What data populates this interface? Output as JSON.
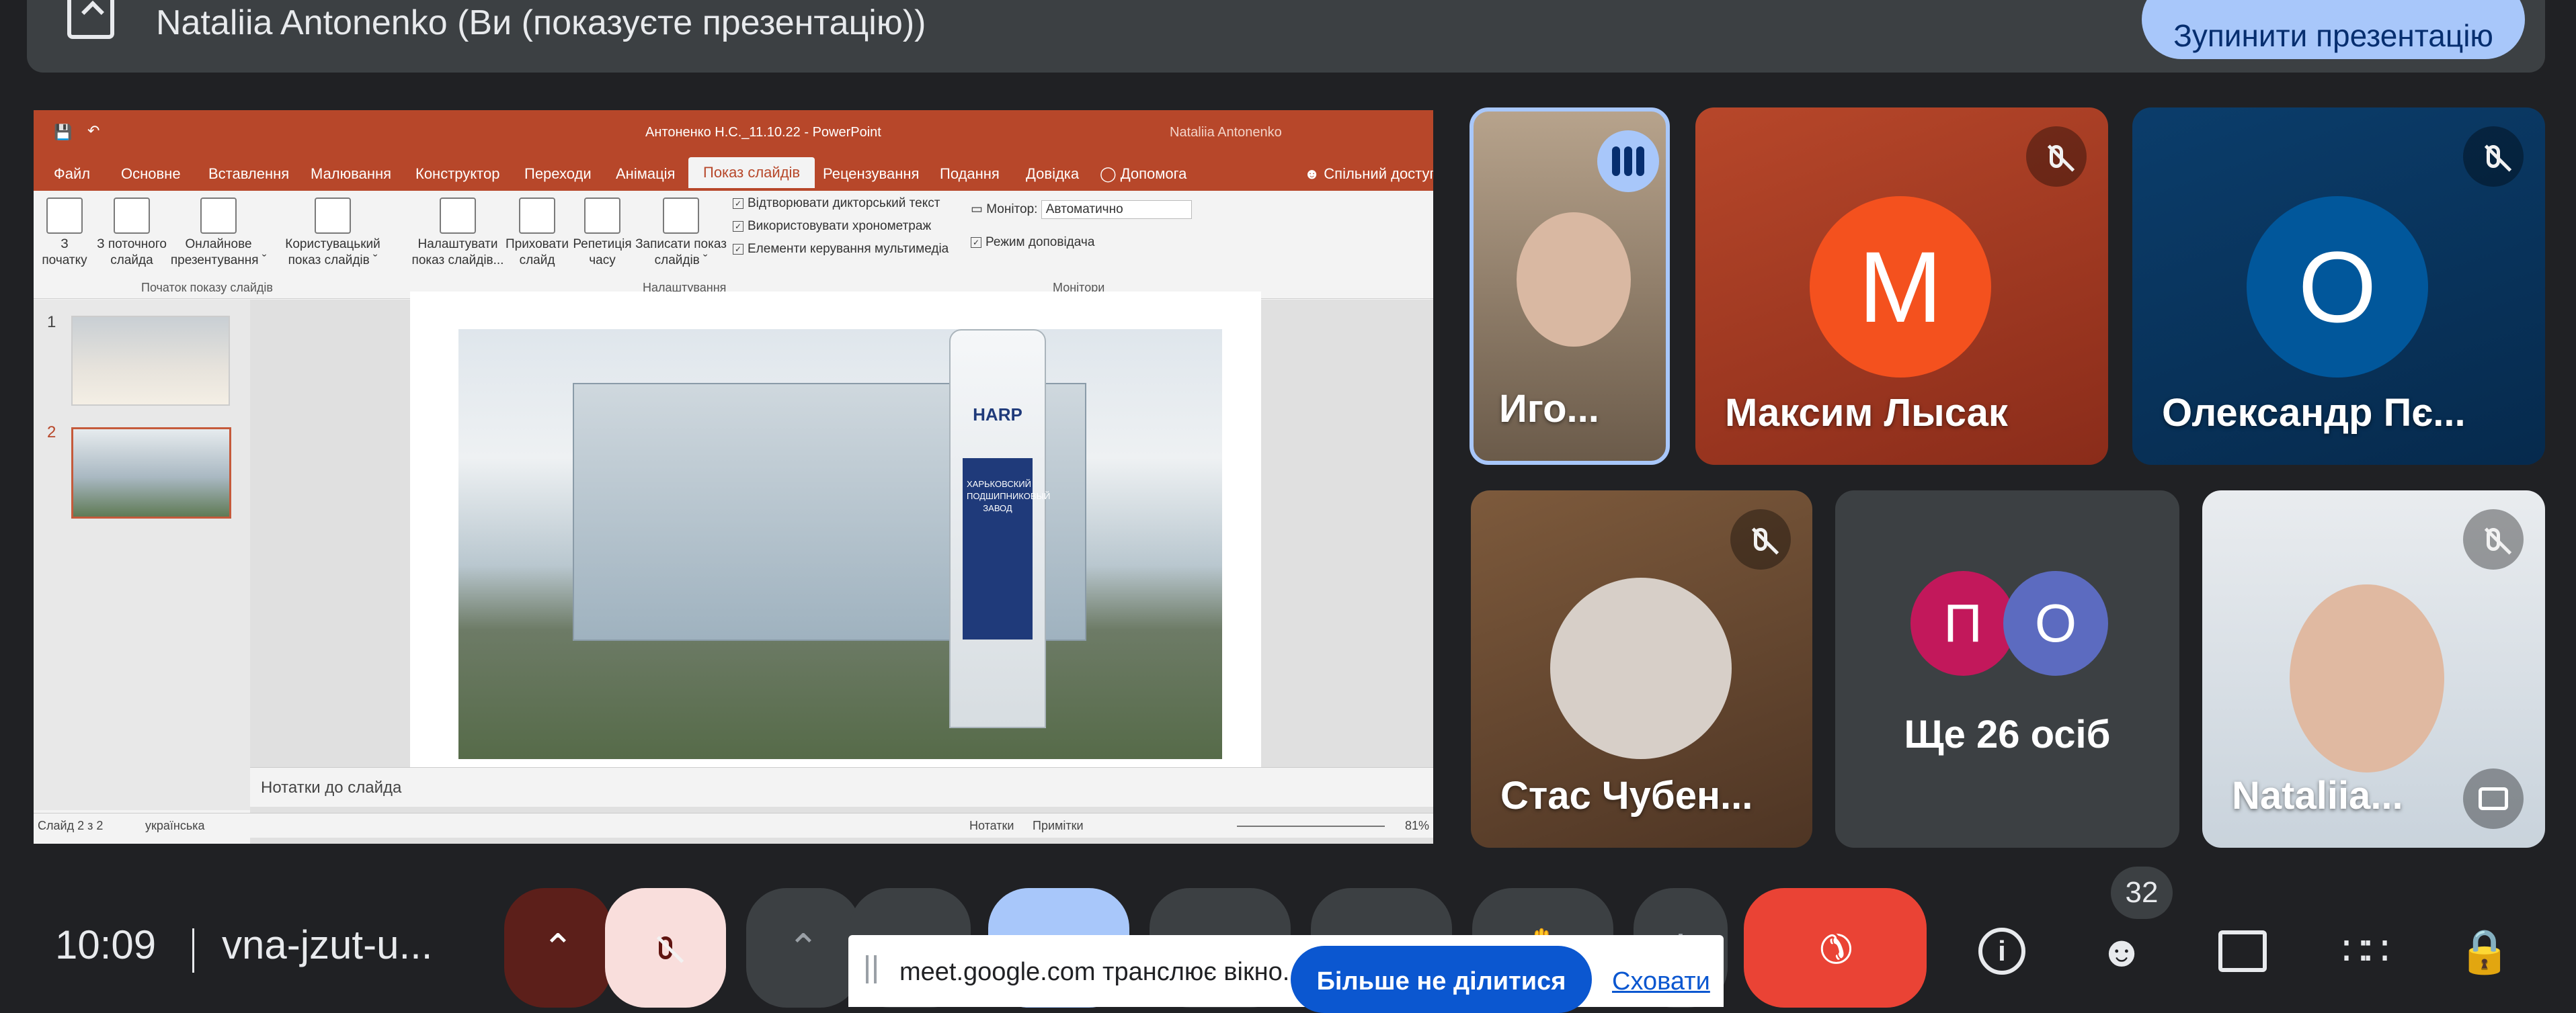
{
  "banner": {
    "title": "Nataliia Antonenko (Ви (показуєте презентацію))",
    "stop_button": "Зупинити презентацію",
    "present_icon": "present-to-all-icon"
  },
  "powerpoint": {
    "window_title": "Антоненко Н.С._11.10.22 - PowerPoint",
    "user_name": "Nataliia Antonenko",
    "tabs": [
      "Файл",
      "Основне",
      "Вставлення",
      "Малювання",
      "Конструктор",
      "Переходи",
      "Анімація",
      "Показ слайдів",
      "Рецензування",
      "Подання",
      "Довідка",
      "Допомога"
    ],
    "active_tab": "Показ слайдів",
    "share_label": "Спільний доступ",
    "ribbon": {
      "start_buttons": [
        "З\nпочатку",
        "З поточного\nслайда",
        "Онлайнове\nпрезентування ˇ",
        "Користувацький\nпоказ слайдів ˇ"
      ],
      "start_group": "Початок показу слайдів",
      "setup_buttons": [
        "Налаштувати\nпоказ слайдів...",
        "Приховати\nслайд",
        "Репетиція\nчасу",
        "Записати показ\nслайдів ˇ"
      ],
      "checks": [
        "Відтворювати дикторський текст",
        "Використовувати хронометраж",
        "Елементи керування мультимедіа"
      ],
      "setup_group": "Налаштування",
      "monitor_label": "Монітор:",
      "monitor_value": "Автоматично",
      "presenter_view": "Режим доповідача",
      "monitors_group": "Монітори"
    },
    "slide_numbers": [
      "1",
      "2"
    ],
    "slide_sign_top": "HARP",
    "slide_sign_text": "ХАРЬКОВСКИЙ ПОДШИПНИКОВЫЙ ЗАВОД",
    "notes_placeholder": "Нотатки до слайда",
    "status": {
      "slide_count": "Слайд 2 з 2",
      "language": "українська",
      "notes": "Нотатки",
      "comments": "Примітки",
      "zoom": "81%"
    }
  },
  "participants": [
    {
      "name": "Иго...",
      "state": "speaking"
    },
    {
      "name": "Максим Лысак",
      "initial": "M",
      "muted": true
    },
    {
      "name": "Олександр Пє...",
      "initial": "O",
      "muted": true
    },
    {
      "name": "Стас Чубен...",
      "muted": true
    },
    {
      "name": "Ще 26 осіб",
      "initials": [
        "П",
        "О"
      ]
    },
    {
      "name": "Nataliia...",
      "muted": true
    }
  ],
  "bottom_bar": {
    "time": "10:09",
    "meeting_code": "vna-jzut-u...",
    "participant_count": "32"
  },
  "share_notice": {
    "text": "meet.google.com транслює вікно.",
    "stop_sharing": "Більше не ділитися",
    "hide": "Сховати"
  },
  "colors": {
    "background": "#202124",
    "accent_blue": "#a8c7fa",
    "leave_red": "#ea4335",
    "ppt_orange": "#b7472a"
  }
}
